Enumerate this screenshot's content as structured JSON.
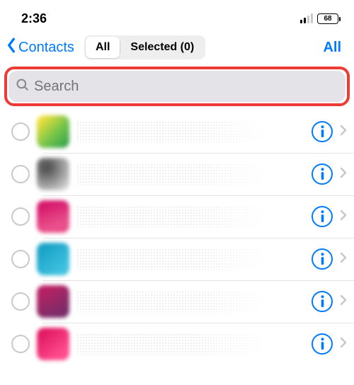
{
  "status": {
    "time": "2:36",
    "battery": "68"
  },
  "nav": {
    "back_label": "Contacts",
    "seg_all": "All",
    "seg_selected": "Selected (0)",
    "all_link": "All"
  },
  "search": {
    "placeholder": "Search"
  },
  "rows": [
    {
      "avatar_class": "av1"
    },
    {
      "avatar_class": "av2"
    },
    {
      "avatar_class": "av3"
    },
    {
      "avatar_class": "av4"
    },
    {
      "avatar_class": "av5"
    },
    {
      "avatar_class": "av6"
    }
  ]
}
